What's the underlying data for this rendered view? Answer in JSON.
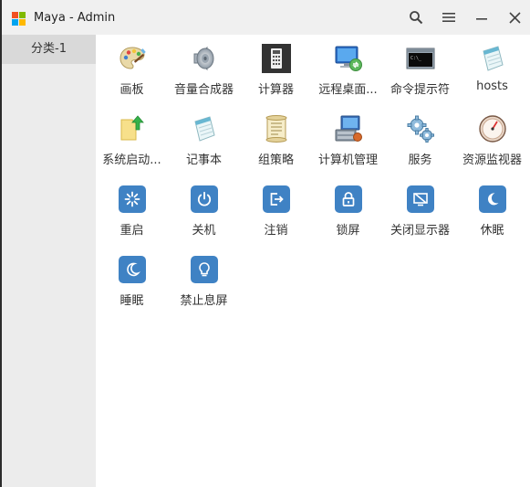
{
  "window": {
    "title": "Maya - Admin",
    "accent": "#3f82c4",
    "logo_colors": [
      "#f25022",
      "#7fba00",
      "#00a4ef",
      "#ffb900"
    ]
  },
  "titlebar": {
    "buttons": [
      {
        "name": "search-button",
        "icon": "search-icon"
      },
      {
        "name": "menu-button",
        "icon": "hamburger-icon"
      },
      {
        "name": "minimize-button",
        "icon": "minimize-icon"
      },
      {
        "name": "close-button",
        "icon": "close-icon"
      }
    ]
  },
  "sidebar": {
    "items": [
      {
        "label": "分类-1",
        "selected": true
      }
    ]
  },
  "tiles": [
    {
      "label": "画板",
      "icon": "paint-palette-icon"
    },
    {
      "label": "音量合成器",
      "icon": "speaker-icon"
    },
    {
      "label": "计算器",
      "icon": "calculator-icon"
    },
    {
      "label": "远程桌面...",
      "icon": "remote-desktop-icon"
    },
    {
      "label": "命令提示符",
      "icon": "command-prompt-icon"
    },
    {
      "label": "hosts",
      "icon": "notepad-icon"
    },
    {
      "label": "系统启动...",
      "icon": "startup-folder-icon"
    },
    {
      "label": "记事本",
      "icon": "notepad-icon"
    },
    {
      "label": "组策略",
      "icon": "group-policy-scroll-icon"
    },
    {
      "label": "计算机管理",
      "icon": "computer-management-icon"
    },
    {
      "label": "服务",
      "icon": "services-gears-icon"
    },
    {
      "label": "资源监视器",
      "icon": "resource-monitor-icon"
    },
    {
      "label": "重启",
      "icon": "restart-icon"
    },
    {
      "label": "关机",
      "icon": "power-icon"
    },
    {
      "label": "注销",
      "icon": "logout-icon"
    },
    {
      "label": "锁屏",
      "icon": "lock-icon"
    },
    {
      "label": "关闭显示器",
      "icon": "monitor-off-icon"
    },
    {
      "label": "休眠",
      "icon": "moon-icon"
    },
    {
      "label": "睡眠",
      "icon": "moon-icon"
    },
    {
      "label": "禁止息屏",
      "icon": "lightbulb-icon"
    }
  ]
}
